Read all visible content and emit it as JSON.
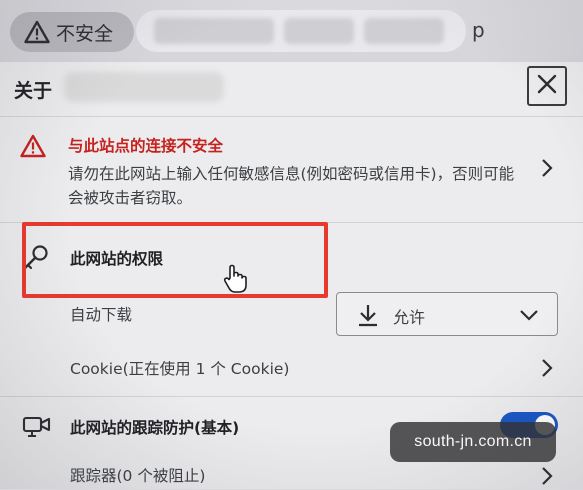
{
  "address_bar": {
    "security_text": "不安全",
    "url_visible_suffix": "p"
  },
  "site_info_panel": {
    "header": {
      "about_label": "关于"
    },
    "connection_warning": {
      "title": "与此站点的连接不安全",
      "body": "请勿在此网站上输入任何敏感信息(例如密码或信用卡)，否则可能会被攻击者窃取。"
    },
    "permissions": {
      "label": "此网站的权限",
      "auto_download": {
        "label": "自动下载",
        "value": "允许"
      }
    },
    "cookies": {
      "label": "Cookie(正在使用 1 个 Cookie)"
    },
    "tracking_prevention": {
      "label": "此网站的跟踪防护(基本)",
      "enabled": true
    },
    "trackers": {
      "label": "跟踪器(0 个被阻止)"
    }
  },
  "watermark": {
    "text": "south-jn.com.cn"
  },
  "colors": {
    "warning_red": "#c5221f",
    "highlight_red": "#e8392f",
    "toggle_blue": "#1a56c4"
  }
}
